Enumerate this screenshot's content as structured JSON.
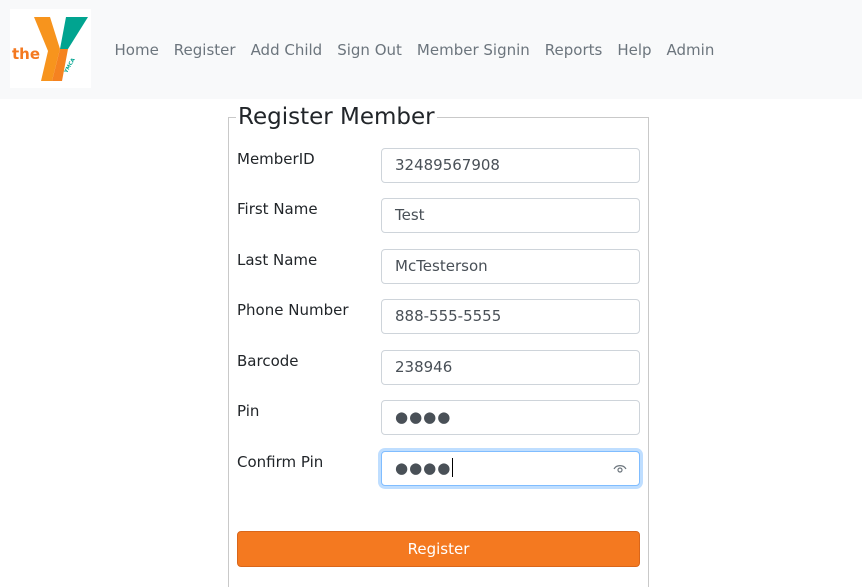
{
  "brand": {
    "logo_text": "the",
    "logo_subtext": "YMCA"
  },
  "nav": {
    "items": [
      "Home",
      "Register",
      "Add Child",
      "Sign Out",
      "Member Signin",
      "Reports",
      "Help",
      "Admin"
    ]
  },
  "form": {
    "title": "Register Member",
    "fields": [
      {
        "label": "MemberID",
        "value": "32489567908"
      },
      {
        "label": "First Name",
        "value": "Test"
      },
      {
        "label": "Last Name",
        "value": "McTesterson"
      },
      {
        "label": "Phone Number",
        "value": "888-555-5555"
      },
      {
        "label": "Barcode",
        "value": "238946"
      },
      {
        "label": "Pin",
        "value": "●●●●"
      },
      {
        "label": "Confirm Pin",
        "value": "●●●●"
      }
    ],
    "submit_label": "Register"
  },
  "colors": {
    "accent": "#f47920",
    "logo_orange": "#f7941d",
    "logo_teal": "#01a490"
  }
}
